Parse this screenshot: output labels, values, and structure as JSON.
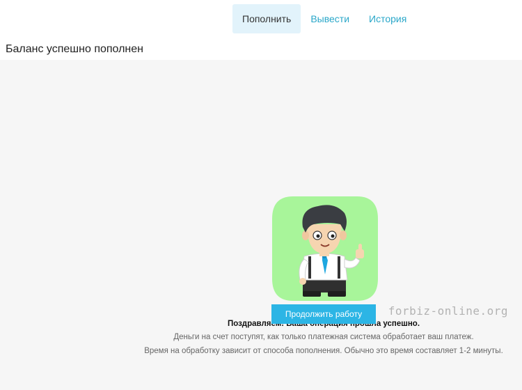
{
  "tabs": [
    {
      "label": "Пополнить",
      "active": true
    },
    {
      "label": "Вывести",
      "active": false
    },
    {
      "label": "История",
      "active": false
    }
  ],
  "page_title": "Баланс успешно пополнен",
  "illustration": {
    "icon": "businessman-thumbs-up-icon",
    "bg_color": "#a8f59a"
  },
  "message": {
    "headline": "Поздравляем! Ваша операция прошла успешно.",
    "line1": "Деньги на счет поступят, как только платежная система обработает ваш платеж.",
    "line2": "Время на обработку зависит от способа пополнения. Обычно это время составляет 1-2 минуты."
  },
  "continue_button": {
    "label": "Продолжить работу",
    "color": "#2cb5e5"
  },
  "watermark": "forbiz-online.org",
  "colors": {
    "accent": "#2aa7c9",
    "active_tab_bg": "#e2f3fb",
    "content_bg": "#f6f6f6"
  }
}
